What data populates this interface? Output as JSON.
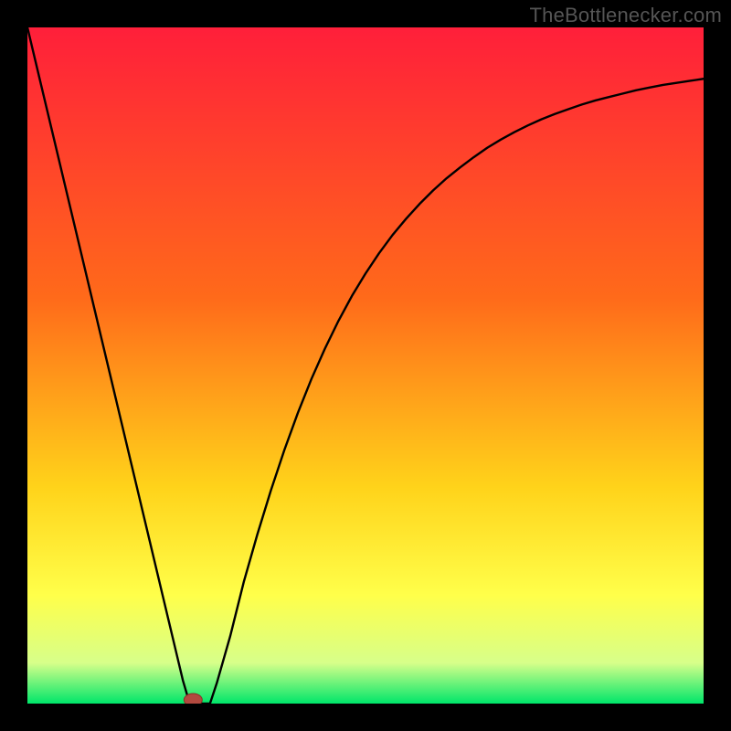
{
  "attribution": "TheBottlenecker.com",
  "colors": {
    "frame": "#000000",
    "gradient_top": "#ff1f3a",
    "gradient_mid1": "#ff6a1a",
    "gradient_mid2": "#ffd31a",
    "gradient_bottom1": "#ffff4a",
    "gradient_bottom2": "#d7ff8a",
    "gradient_bottom3": "#00e66a",
    "curve": "#000000",
    "marker_fill": "#b24a3f",
    "marker_stroke": "#8a2f26"
  },
  "chart_data": {
    "type": "line",
    "title": "",
    "xlabel": "",
    "ylabel": "",
    "xlim": [
      0,
      100
    ],
    "ylim": [
      0,
      100
    ],
    "x": [
      0,
      2,
      4,
      6,
      8,
      10,
      12,
      14,
      16,
      18,
      20,
      21,
      22,
      23,
      24,
      25,
      26,
      27,
      28,
      30,
      32,
      34,
      36,
      38,
      40,
      42,
      44,
      46,
      48,
      50,
      52,
      54,
      56,
      58,
      60,
      62,
      64,
      66,
      68,
      70,
      72,
      74,
      76,
      78,
      80,
      82,
      84,
      86,
      88,
      90,
      92,
      94,
      96,
      98,
      100
    ],
    "values": [
      100,
      91.6,
      83.2,
      74.8,
      66.4,
      58,
      49.6,
      41.2,
      32.8,
      24.4,
      16,
      11.8,
      7.6,
      3.4,
      0,
      0,
      0,
      0,
      3,
      10,
      18,
      25,
      31.5,
      37.5,
      43,
      48,
      52.5,
      56.6,
      60.3,
      63.6,
      66.6,
      69.3,
      71.7,
      73.9,
      75.9,
      77.7,
      79.3,
      80.8,
      82.2,
      83.4,
      84.5,
      85.5,
      86.4,
      87.2,
      87.9,
      88.6,
      89.2,
      89.7,
      90.2,
      90.7,
      91.1,
      91.5,
      91.8,
      92.1,
      92.4
    ],
    "marker": {
      "x": 24.5,
      "y": 0
    },
    "annotations": []
  }
}
